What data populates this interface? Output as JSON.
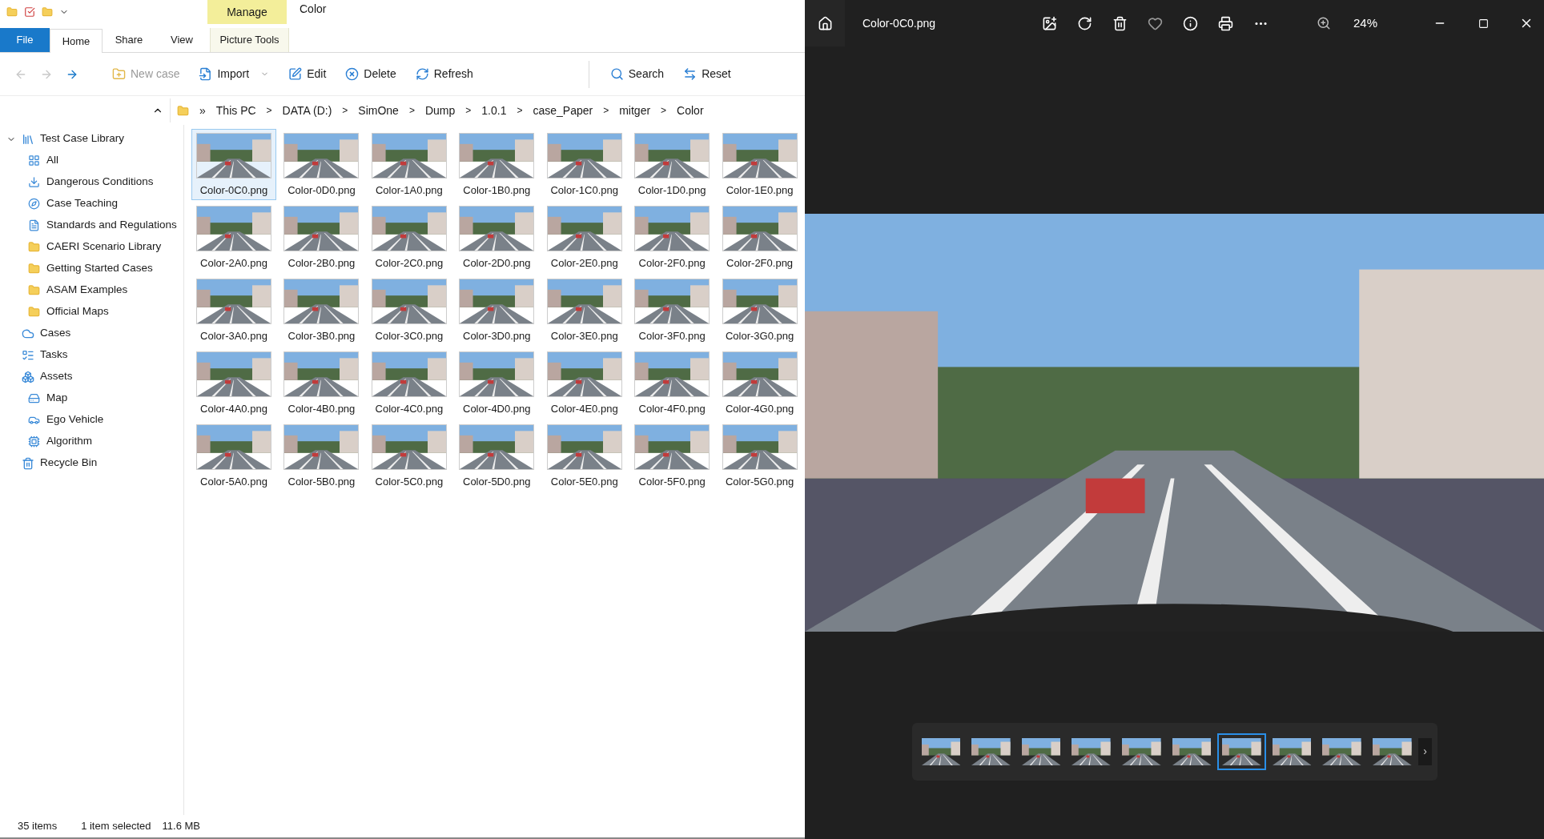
{
  "explorer": {
    "title": "Color",
    "context_tab": "Manage",
    "tabs": [
      {
        "label": "File",
        "kind": "file",
        "selected": false
      },
      {
        "label": "Home",
        "kind": "tab",
        "selected": true
      },
      {
        "label": "Share",
        "kind": "tab",
        "selected": false
      },
      {
        "label": "View",
        "kind": "tab",
        "selected": false
      },
      {
        "label": "Picture Tools",
        "kind": "context",
        "selected": false
      }
    ],
    "nav": [
      {
        "kind": "back",
        "disabled": true
      },
      {
        "kind": "forward",
        "disabled": true
      },
      {
        "kind": "up",
        "disabled": false
      }
    ],
    "toolbar": [
      {
        "label": "New case",
        "kind": "new",
        "disabled": true
      },
      {
        "label": "Import",
        "kind": "import",
        "disabled": false,
        "dropdown": true
      },
      {
        "label": "Edit",
        "kind": "edit",
        "disabled": false
      },
      {
        "label": "Delete",
        "kind": "delete",
        "disabled": false
      },
      {
        "label": "Refresh",
        "kind": "refresh",
        "disabled": false
      },
      {
        "label": "Search",
        "kind": "search",
        "disabled": false
      },
      {
        "label": "Reset",
        "kind": "reset",
        "disabled": false
      }
    ],
    "breadcrumb_overflow": "»",
    "breadcrumb": [
      {
        "label": "This PC"
      },
      {
        "separator": ">",
        "label": "DATA (D:)"
      },
      {
        "separator": ">",
        "label": "SimOne"
      },
      {
        "separator": ">",
        "label": "Dump"
      },
      {
        "separator": ">",
        "label": "1.0.1"
      },
      {
        "separator": ">",
        "label": "case_Paper"
      },
      {
        "separator": ">",
        "label": "mitger"
      },
      {
        "separator": ">",
        "label": "Color"
      }
    ],
    "sidebar": [
      {
        "label": "Test Case Library",
        "kind": "library",
        "expanded": true,
        "children": [
          {
            "label": "All",
            "kind": "all"
          },
          {
            "label": "Dangerous Conditions",
            "kind": "danger"
          },
          {
            "label": "Case Teaching",
            "kind": "teach"
          },
          {
            "label": "Standards and Regulations",
            "kind": "doc"
          },
          {
            "label": "CAERI Scenario Library",
            "kind": "folder"
          },
          {
            "label": "Getting Started Cases",
            "kind": "folder"
          },
          {
            "label": "ASAM Examples",
            "kind": "folder"
          },
          {
            "label": "Official Maps",
            "kind": "folder"
          }
        ]
      },
      {
        "label": "Cases",
        "kind": "cloud"
      },
      {
        "label": "Tasks",
        "kind": "tasks"
      },
      {
        "label": "Assets",
        "kind": "assets",
        "children": [
          {
            "label": "Map",
            "kind": "drive"
          },
          {
            "label": "Ego Vehicle",
            "kind": "car"
          },
          {
            "label": "Algorithm",
            "kind": "algo"
          }
        ]
      },
      {
        "label": "Recycle Bin",
        "kind": "bin"
      }
    ],
    "files": [
      {
        "name": "Color-0C0.png",
        "selected": true
      },
      {
        "name": "Color-0D0.png",
        "selected": false
      },
      {
        "name": "Color-1A0.png",
        "selected": false
      },
      {
        "name": "Color-1B0.png",
        "selected": false
      },
      {
        "name": "Color-1C0.png",
        "selected": false
      },
      {
        "name": "Color-1D0.png",
        "selected": false
      },
      {
        "name": "Color-1E0.png",
        "selected": false
      },
      {
        "name": "Color-2A0.png",
        "selected": false
      },
      {
        "name": "Color-2B0.png",
        "selected": false
      },
      {
        "name": "Color-2C0.png",
        "selected": false
      },
      {
        "name": "Color-2D0.png",
        "selected": false
      },
      {
        "name": "Color-2E0.png",
        "selected": false
      },
      {
        "name": "Color-2F0.png",
        "selected": false
      },
      {
        "name": "Color-2F0.png",
        "selected": false
      },
      {
        "name": "Color-3A0.png",
        "selected": false
      },
      {
        "name": "Color-3B0.png",
        "selected": false
      },
      {
        "name": "Color-3C0.png",
        "selected": false
      },
      {
        "name": "Color-3D0.png",
        "selected": false
      },
      {
        "name": "Color-3E0.png",
        "selected": false
      },
      {
        "name": "Color-3F0.png",
        "selected": false
      },
      {
        "name": "Color-3G0.png",
        "selected": false
      },
      {
        "name": "Color-4A0.png",
        "selected": false
      },
      {
        "name": "Color-4B0.png",
        "selected": false
      },
      {
        "name": "Color-4C0.png",
        "selected": false
      },
      {
        "name": "Color-4D0.png",
        "selected": false
      },
      {
        "name": "Color-4E0.png",
        "selected": false
      },
      {
        "name": "Color-4F0.png",
        "selected": false
      },
      {
        "name": "Color-4G0.png",
        "selected": false
      },
      {
        "name": "Color-5A0.png",
        "selected": false
      },
      {
        "name": "Color-5B0.png",
        "selected": false
      },
      {
        "name": "Color-5C0.png",
        "selected": false
      },
      {
        "name": "Color-5D0.png",
        "selected": false
      },
      {
        "name": "Color-5E0.png",
        "selected": false
      },
      {
        "name": "Color-5F0.png",
        "selected": false
      },
      {
        "name": "Color-5G0.png",
        "selected": false
      }
    ],
    "status": [
      "35 items",
      "1 item selected",
      "11.6 MB"
    ]
  },
  "viewer": {
    "title": "Color-0C0.png",
    "zoom": "24%",
    "filmstrip": [
      {
        "selected": false
      },
      {
        "selected": false
      },
      {
        "selected": false
      },
      {
        "selected": false
      },
      {
        "selected": false
      },
      {
        "selected": false
      },
      {
        "selected": true
      },
      {
        "selected": false
      },
      {
        "selected": false
      },
      {
        "selected": false
      }
    ],
    "next": "›"
  }
}
